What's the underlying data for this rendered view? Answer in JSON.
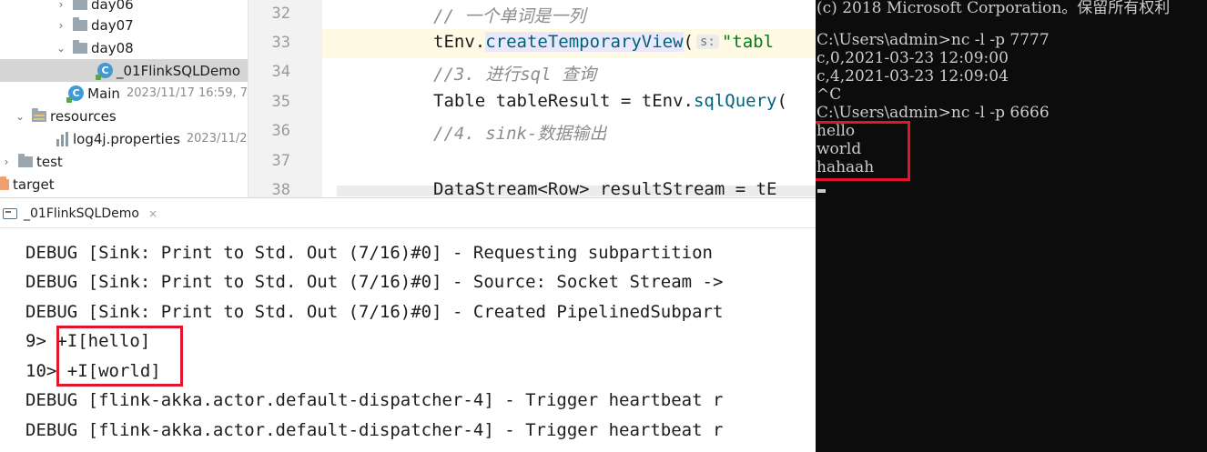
{
  "tree": {
    "items": [
      {
        "label": "day06",
        "arrow": "›",
        "icon": "folder-icon"
      },
      {
        "label": "day07",
        "arrow": "›",
        "icon": "folder-icon"
      },
      {
        "label": "day08",
        "arrow": "⌄",
        "icon": "folder-icon"
      },
      {
        "label": "_01FlinkSQLDemo",
        "icon": "java-class-icon",
        "selected": true
      },
      {
        "label": "Main",
        "date": "2023/11/17 16:59, 7",
        "icon": "java-class-icon"
      },
      {
        "label": "resources",
        "arrow": "⌄",
        "icon": "resources-folder-icon"
      },
      {
        "label": "log4j.properties",
        "date": "2023/11/2",
        "icon": "properties-file-icon"
      },
      {
        "label": "test",
        "arrow": "›",
        "icon": "folder-icon"
      },
      {
        "label": "target",
        "icon": "target-folder-icon"
      }
    ]
  },
  "editor": {
    "line_numbers": [
      "32",
      "33",
      "34",
      "35",
      "36",
      "37",
      "38"
    ],
    "lines": {
      "l32": "// 一个单词是一列",
      "l33_obj": "tEnv.",
      "l33_method": "createTemporaryView",
      "l33_paren": "(",
      "l33_hint": "s:",
      "l33_str": "\"tabl",
      "l34": "//3. 进行sql 查询",
      "l35_a": "Table tableResult = tEnv.",
      "l35_method": "sqlQuery",
      "l35_b": "(",
      "l36": "//4. sink-数据输出",
      "l38": "DataStream<Row> resultStream = tE"
    }
  },
  "run_tab": {
    "label": "_01FlinkSQLDemo",
    "close": "×"
  },
  "console": {
    "lines": [
      "DEBUG [Sink: Print to Std. Out (7/16)#0] - Requesting subpartition",
      "DEBUG [Sink: Print to Std. Out (7/16)#0] - Source: Socket Stream ->",
      "DEBUG [Sink: Print to Std. Out (7/16)#0] - Created PipelinedSubpart",
      "9> +I[hello]",
      "10> +I[world]",
      "DEBUG [flink-akka.actor.default-dispatcher-4] - Trigger heartbeat r",
      "DEBUG [flink-akka.actor.default-dispatcher-4] - Trigger heartbeat r"
    ]
  },
  "terminal": {
    "lines": [
      "(c) 2018 Microsoft Corporation。保留所有权利",
      "",
      "C:\\Users\\admin>nc -l -p 7777",
      "c,0,2021-03-23 12:09:00",
      "c,4,2021-03-23 12:09:04",
      "^C",
      "C:\\Users\\admin>nc -l -p 6666",
      "hello",
      "world",
      "hahaah"
    ]
  },
  "colors": {
    "highlight_box": "#e1162a",
    "terminal_bg": "#0c0c0c",
    "selected_row": "#d5d5d5",
    "comment": "#8c8c8c",
    "method": "#00627a",
    "string": "#067d17"
  }
}
